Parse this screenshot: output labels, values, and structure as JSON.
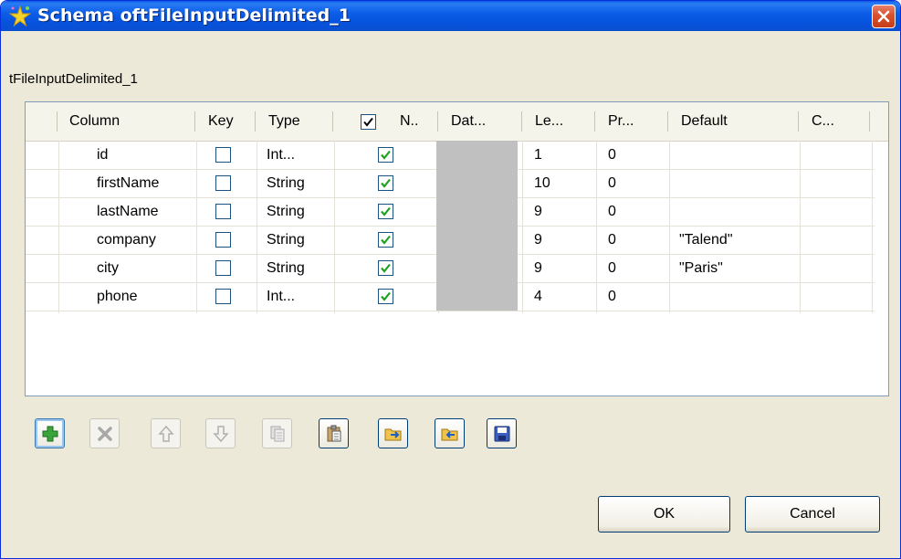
{
  "window": {
    "title": "Schema oftFileInputDelimited_1",
    "component_label": "tFileInputDelimited_1"
  },
  "table": {
    "headers": {
      "column": "Column",
      "key": "Key",
      "type": "Type",
      "nullable": "N..",
      "nullable_header_checked": true,
      "date_pattern": "Dat...",
      "length": "Le...",
      "precision": "Pr...",
      "default": "Default",
      "comment": "C..."
    },
    "rows": [
      {
        "column": "id",
        "key": false,
        "type": "Int...",
        "nullable": true,
        "length": "1",
        "precision": "0",
        "default": ""
      },
      {
        "column": "firstName",
        "key": false,
        "type": "String",
        "nullable": true,
        "length": "10",
        "precision": "0",
        "default": ""
      },
      {
        "column": "lastName",
        "key": false,
        "type": "String",
        "nullable": true,
        "length": "9",
        "precision": "0",
        "default": ""
      },
      {
        "column": "company",
        "key": false,
        "type": "String",
        "nullable": true,
        "length": "9",
        "precision": "0",
        "default": "\"Talend\""
      },
      {
        "column": "city",
        "key": false,
        "type": "String",
        "nullable": true,
        "length": "9",
        "precision": "0",
        "default": "\"Paris\""
      },
      {
        "column": "phone",
        "key": false,
        "type": "Int...",
        "nullable": true,
        "length": "4",
        "precision": "0",
        "default": ""
      }
    ]
  },
  "toolbar": [
    {
      "icon": "add-icon",
      "enabled": true
    },
    {
      "icon": "delete-icon",
      "enabled": false
    },
    {
      "icon": "move-up-icon",
      "enabled": false
    },
    {
      "icon": "move-down-icon",
      "enabled": false
    },
    {
      "icon": "copy-icon",
      "enabled": false
    },
    {
      "icon": "paste-icon",
      "enabled": true
    },
    {
      "icon": "import-icon",
      "enabled": true
    },
    {
      "icon": "export-icon",
      "enabled": true
    },
    {
      "icon": "save-icon",
      "enabled": true
    }
  ],
  "buttons": {
    "ok": "OK",
    "cancel": "Cancel"
  },
  "colors": {
    "title_bar": "#0a58e8",
    "window_bg": "#ece9d8",
    "check_green": "#21a121",
    "close_red": "#d9512f"
  }
}
